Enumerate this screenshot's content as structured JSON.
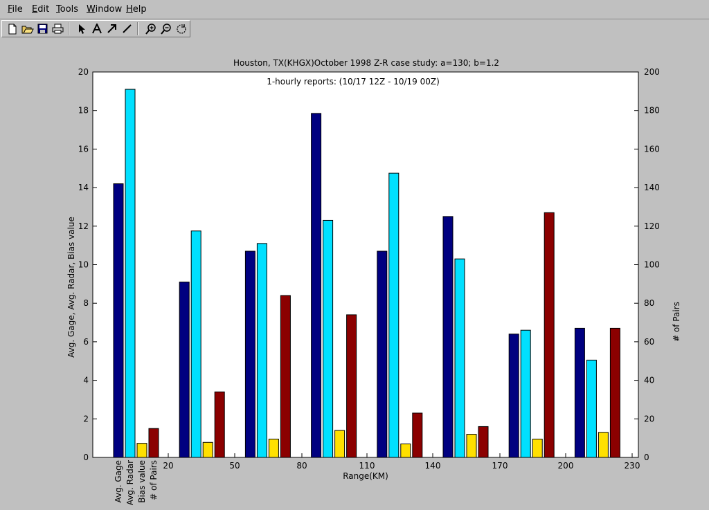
{
  "menu": [
    "File",
    "Edit",
    "Tools",
    "Window",
    "Help"
  ],
  "toolbar": [
    {
      "name": "new-file-icon"
    },
    {
      "name": "open-folder-icon"
    },
    {
      "name": "save-icon"
    },
    {
      "name": "print-icon"
    },
    {
      "name": "arrow-pointer-icon"
    },
    {
      "name": "text-tool-icon"
    },
    {
      "name": "arrow-tool-icon"
    },
    {
      "name": "line-tool-icon"
    },
    {
      "name": "zoom-in-icon"
    },
    {
      "name": "zoom-out-icon"
    },
    {
      "name": "rotate-icon"
    }
  ],
  "chart_data": {
    "type": "bar",
    "title": "Houston, TX(KHGX)October 1998 Z-R case study: a=130; b=1.2",
    "subtitle": "1-hourly reports: (10/17 12Z - 10/19 00Z)",
    "xlabel": "Range(KM)",
    "ylabel": "Avg. Gage, Avg. Radar, Bias value",
    "ylabel_right": "# of Pairs",
    "ylim": [
      0,
      20
    ],
    "ylim_right": [
      0,
      200
    ],
    "yticks": [
      0,
      2,
      4,
      6,
      8,
      10,
      12,
      14,
      16,
      18,
      20
    ],
    "yticks_right": [
      0,
      20,
      40,
      60,
      80,
      100,
      120,
      140,
      160,
      180,
      200
    ],
    "xticks": [
      "20",
      "50",
      "80",
      "110",
      "140",
      "170",
      "200",
      "230"
    ],
    "category_labels": [
      "Avg. Gage",
      "Avg. Radar",
      "Bias value",
      "# of Pairs"
    ],
    "series": [
      {
        "name": "Avg. Gage",
        "axis": "left",
        "color": "#000080",
        "values": [
          14.2,
          9.1,
          10.7,
          17.85,
          10.7,
          12.5,
          6.4,
          6.7
        ]
      },
      {
        "name": "Avg. Radar",
        "axis": "left",
        "color": "#00e0ff",
        "values": [
          19.1,
          11.75,
          11.1,
          12.3,
          14.75,
          10.3,
          6.6,
          5.05
        ]
      },
      {
        "name": "Bias value",
        "axis": "left",
        "color": "#ffe000",
        "values": [
          0.73,
          0.78,
          0.95,
          1.4,
          0.7,
          1.2,
          0.95,
          1.3
        ]
      },
      {
        "name": "# of Pairs",
        "axis": "right",
        "color": "#8b0000",
        "values": [
          15,
          34,
          84,
          74,
          23,
          16,
          127,
          67
        ]
      }
    ],
    "grid": false,
    "legend": "none"
  }
}
